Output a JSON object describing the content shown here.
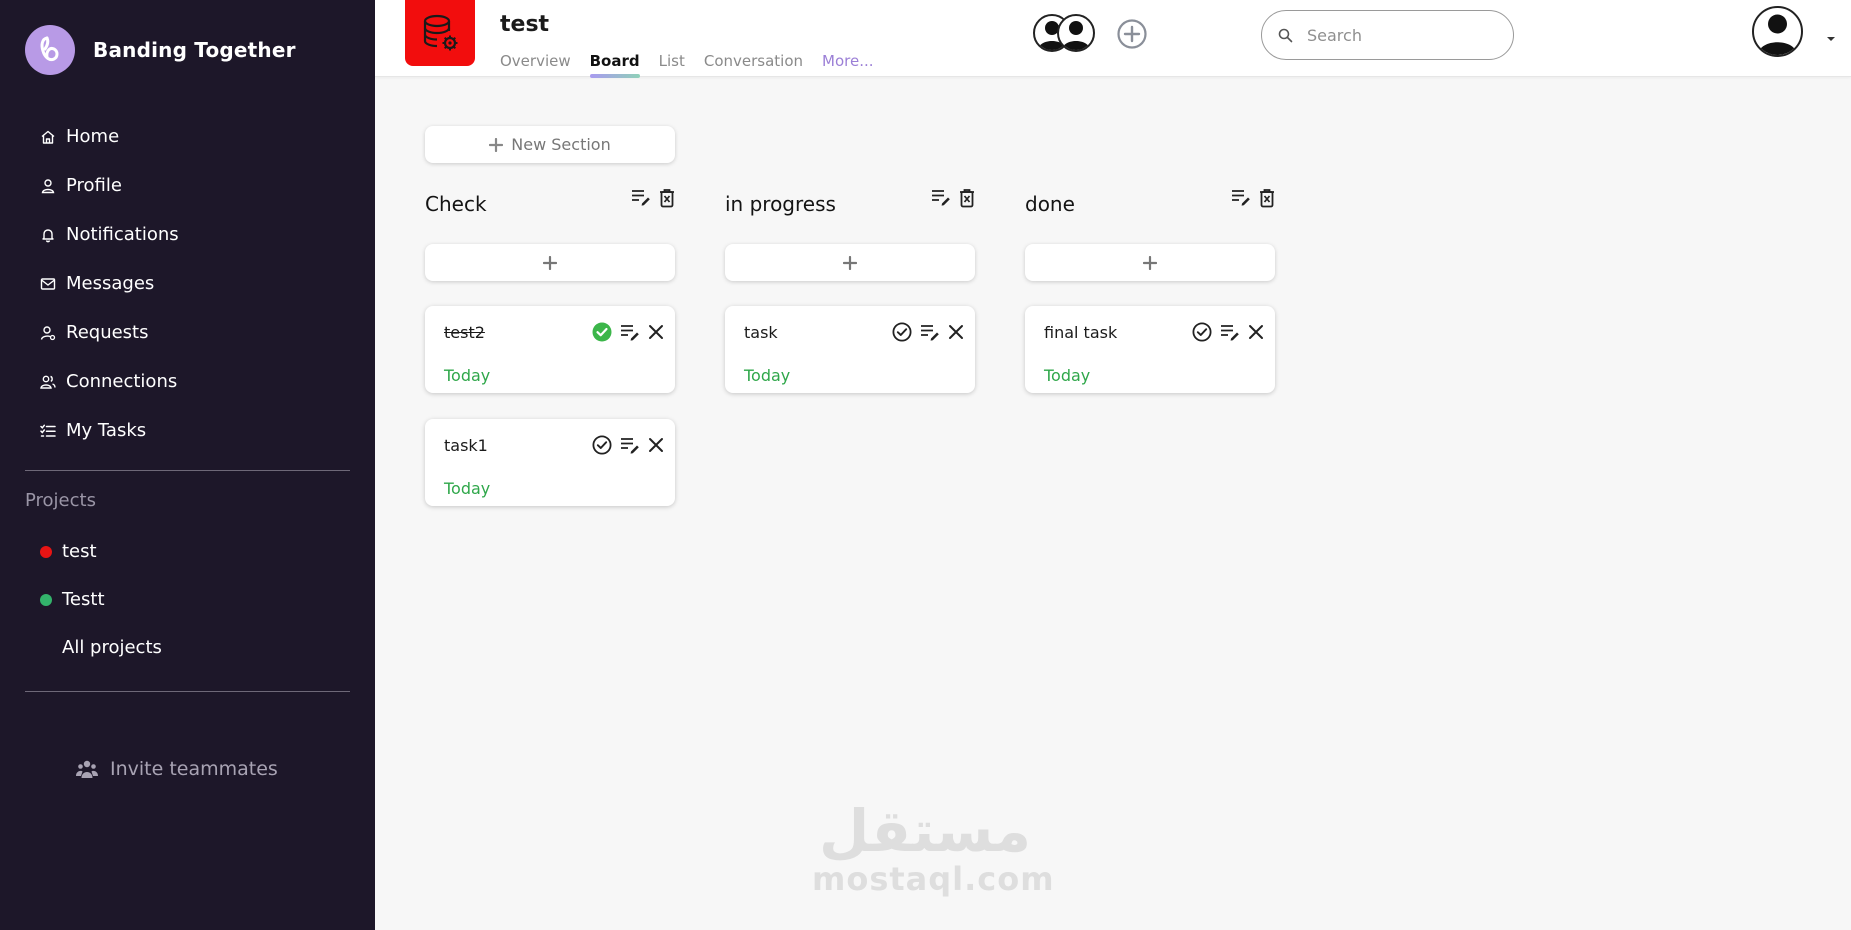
{
  "brand": {
    "name": "Banding Together"
  },
  "nav": {
    "items": [
      {
        "label": "Home",
        "icon": "home-icon"
      },
      {
        "label": "Profile",
        "icon": "user-icon"
      },
      {
        "label": "Notifications",
        "icon": "bell-icon"
      },
      {
        "label": "Messages",
        "icon": "envelope-icon"
      },
      {
        "label": "Requests",
        "icon": "user-request-icon"
      },
      {
        "label": "Connections",
        "icon": "users-icon"
      },
      {
        "label": "My Tasks",
        "icon": "task-list-icon"
      }
    ]
  },
  "projects": {
    "label": "Projects",
    "items": [
      {
        "label": "test",
        "color": "#e81414"
      },
      {
        "label": "Testt",
        "color": "#33b36b"
      }
    ],
    "all_label": "All projects"
  },
  "invite": {
    "label": "Invite teammates"
  },
  "header": {
    "project_title": "test",
    "project_color": "#f20d0d",
    "tabs": [
      {
        "label": "Overview"
      },
      {
        "label": "Board",
        "active": true
      },
      {
        "label": "List"
      },
      {
        "label": "Conversation"
      },
      {
        "label": "More..."
      }
    ],
    "search_placeholder": "Search"
  },
  "board": {
    "new_section_label": "New Section",
    "columns": [
      {
        "title": "Check",
        "cards": [
          {
            "name": "test2",
            "due": "Today",
            "completed": true
          },
          {
            "name": "task1",
            "due": "Today",
            "completed": false
          }
        ]
      },
      {
        "title": "in progress",
        "cards": [
          {
            "name": "task",
            "due": "Today",
            "completed": false
          }
        ]
      },
      {
        "title": "done",
        "cards": [
          {
            "name": "final task",
            "due": "Today",
            "completed": false
          }
        ]
      }
    ]
  },
  "watermark": {
    "arabic": "مستقل",
    "latin": "mostaql.com"
  }
}
